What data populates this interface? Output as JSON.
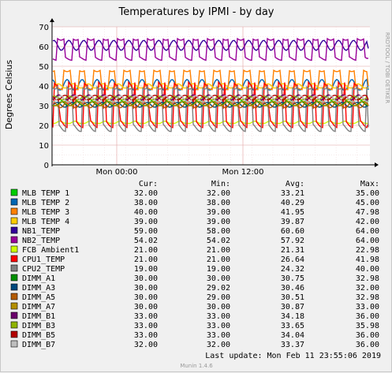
{
  "chart_data": {
    "type": "line",
    "title": "Temperatures by IPMI - by day",
    "ylabel": "Degrees Celsius",
    "watermark": "RRDTOOL / TOBI OETIKER",
    "ylim": [
      0,
      70
    ],
    "yticks": [
      0,
      10,
      20,
      30,
      40,
      50,
      60,
      70
    ],
    "xticks": [
      "Mon 00:00",
      "Mon 12:00"
    ],
    "grid": true,
    "legend_headers": [
      "Cur:",
      "Min:",
      "Avg:",
      "Max:"
    ],
    "series": [
      {
        "name": "MLB TEMP 1",
        "color": "#00cc00",
        "cur": "32.00",
        "min": "32.00",
        "avg": "33.21",
        "max": "35.00"
      },
      {
        "name": "MLB TEMP 2",
        "color": "#0066b3",
        "cur": "38.00",
        "min": "38.00",
        "avg": "40.29",
        "max": "45.00"
      },
      {
        "name": "MLB TEMP 3",
        "color": "#ff8000",
        "cur": "40.00",
        "min": "39.00",
        "avg": "41.95",
        "max": "47.98"
      },
      {
        "name": "MLB TEMP 4",
        "color": "#ffcc00",
        "cur": "39.00",
        "min": "39.00",
        "avg": "39.87",
        "max": "42.00"
      },
      {
        "name": "NB1_TEMP",
        "color": "#330099",
        "cur": "59.00",
        "min": "58.00",
        "avg": "60.60",
        "max": "64.00"
      },
      {
        "name": "NB2_TEMP",
        "color": "#990099",
        "cur": "54.02",
        "min": "54.02",
        "avg": "57.92",
        "max": "64.00"
      },
      {
        "name": "FCB Ambient1",
        "color": "#ccff00",
        "cur": "21.00",
        "min": "21.00",
        "avg": "21.31",
        "max": "22.98"
      },
      {
        "name": "CPU1_TEMP",
        "color": "#ff0000",
        "cur": "21.00",
        "min": "21.00",
        "avg": "26.64",
        "max": "41.98"
      },
      {
        "name": "CPU2_TEMP",
        "color": "#808080",
        "cur": "19.00",
        "min": "19.00",
        "avg": "24.32",
        "max": "40.00"
      },
      {
        "name": "DIMM_A1",
        "color": "#008f00",
        "cur": "30.00",
        "min": "30.00",
        "avg": "30.75",
        "max": "32.98"
      },
      {
        "name": "DIMM_A3",
        "color": "#00487d",
        "cur": "30.00",
        "min": "29.02",
        "avg": "30.46",
        "max": "32.00"
      },
      {
        "name": "DIMM_A5",
        "color": "#b35a00",
        "cur": "30.00",
        "min": "29.00",
        "avg": "30.51",
        "max": "32.98"
      },
      {
        "name": "DIMM_A7",
        "color": "#b38f00",
        "cur": "30.00",
        "min": "30.00",
        "avg": "30.87",
        "max": "33.00"
      },
      {
        "name": "DIMM_B1",
        "color": "#6b006b",
        "cur": "33.00",
        "min": "33.00",
        "avg": "34.18",
        "max": "36.00"
      },
      {
        "name": "DIMM_B3",
        "color": "#8fb300",
        "cur": "33.00",
        "min": "33.00",
        "avg": "33.65",
        "max": "35.98"
      },
      {
        "name": "DIMM_B5",
        "color": "#b30000",
        "cur": "33.00",
        "min": "33.00",
        "avg": "34.04",
        "max": "36.00"
      },
      {
        "name": "DIMM_B7",
        "color": "#bebebe",
        "cur": "32.00",
        "min": "32.00",
        "avg": "33.37",
        "max": "36.00"
      }
    ],
    "last_update_label": "Last update:",
    "last_update": "Mon Feb 11 23:55:06 2019",
    "footer": "Munin 1.4.6"
  }
}
